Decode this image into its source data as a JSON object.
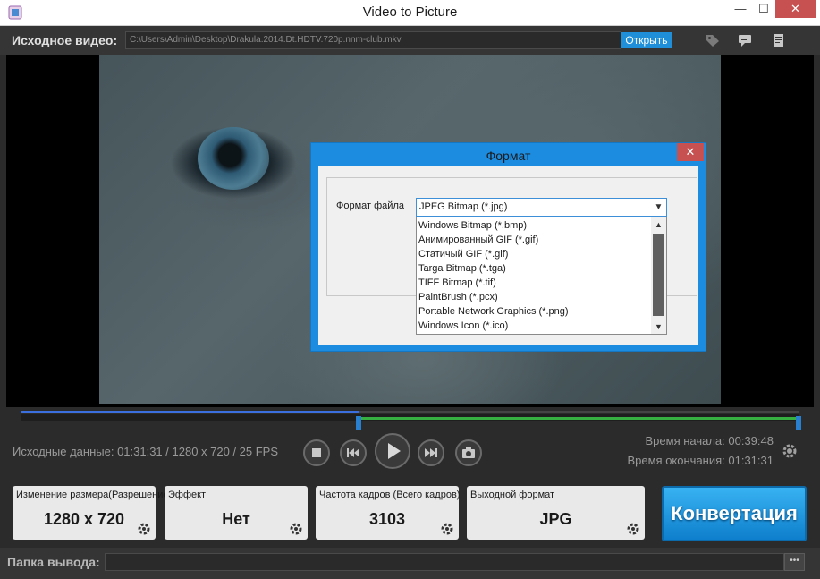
{
  "window": {
    "title": "Video to Picture",
    "min_glyph": "—",
    "max_glyph": "☐",
    "close_glyph": "✕"
  },
  "source": {
    "label": "Исходное видео:",
    "path": "C:\\Users\\Admin\\Desktop\\Drakula.2014.Dt.HDTV.720p.nnm-club.mkv",
    "open_label": "Открыть"
  },
  "toolbar_icons": [
    "tag-icon",
    "chat-icon",
    "list-icon"
  ],
  "dialog": {
    "title": "Формат",
    "close_glyph": "✕",
    "format_label": "Формат файла",
    "selected": "JPEG Bitmap (*.jpg)",
    "options": [
      "Windows Bitmap (*.bmp)",
      "Анимированный GIF (*.gif)",
      "Статичый GIF (*.gif)",
      "Targa Bitmap (*.tga)",
      "TIFF Bitmap (*.tif)",
      "PaintBrush (*.pcx)",
      "Portable Network Graphics (*.png)",
      "Windows Icon (*.ico)"
    ]
  },
  "timeline": {
    "playback_progress": 0.434,
    "range_start": 0.434,
    "range_end": 1.0
  },
  "info": {
    "source_data": "Исходные данные: 01:31:31 / 1280 x 720 / 25 FPS",
    "start_time": "Время начала: 00:39:48",
    "end_time": "Время окончания: 01:31:31"
  },
  "panels": {
    "resize": {
      "label": "Изменение размера(Разрешение)",
      "value": "1280 x 720"
    },
    "effect": {
      "label": "Эффект",
      "value": "Нет"
    },
    "frame_rate": {
      "label": "Частота кадров (Всего кадров)",
      "value": "3103"
    },
    "output_format": {
      "label": "Выходной формат",
      "value": "JPG"
    }
  },
  "convert_label": "Конвертация",
  "output": {
    "label": "Папка вывода:",
    "path": "",
    "browse_label": "•••"
  }
}
